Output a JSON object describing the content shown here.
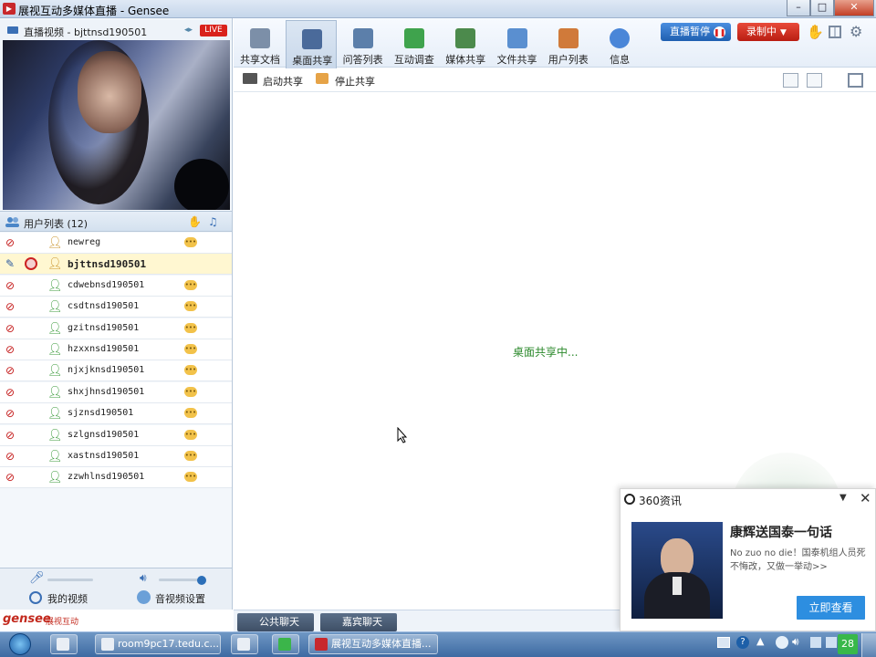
{
  "window": {
    "title": "展视互动多媒体直播 - Gensee",
    "app_icon": "gensee-logo-icon",
    "min": "–",
    "max": "□",
    "close": "✕"
  },
  "video_panel": {
    "title": "直播视频 - bjttnsd190501",
    "live_badge": "LIVE"
  },
  "user_list": {
    "title": "用户列表 (12)",
    "users": [
      {
        "name": "newreg",
        "role": "guest",
        "mic": "muted",
        "selected": false
      },
      {
        "name": "bjttnsd190501",
        "role": "host",
        "mic": "active",
        "selected": true
      },
      {
        "name": "cdwebnsd190501",
        "role": "user",
        "mic": "muted",
        "selected": false
      },
      {
        "name": "csdtnsd190501",
        "role": "user",
        "mic": "muted",
        "selected": false
      },
      {
        "name": "gzitnsd190501",
        "role": "user",
        "mic": "muted",
        "selected": false
      },
      {
        "name": "hzxxnsd190501",
        "role": "user",
        "mic": "muted",
        "selected": false
      },
      {
        "name": "njxjknsd190501",
        "role": "user",
        "mic": "muted",
        "selected": false
      },
      {
        "name": "shxjhnsd190501",
        "role": "user",
        "mic": "muted",
        "selected": false
      },
      {
        "name": "sjznsd190501",
        "role": "user",
        "mic": "muted",
        "selected": false
      },
      {
        "name": "szlgnsd190501",
        "role": "user",
        "mic": "muted",
        "selected": false
      },
      {
        "name": "xastnsd190501",
        "role": "user",
        "mic": "muted",
        "selected": false
      },
      {
        "name": "zzwhlnsd190501",
        "role": "user",
        "mic": "muted",
        "selected": false
      }
    ]
  },
  "bottom_controls": {
    "my_video": "我的视频",
    "av_settings": "音视频设置",
    "mic_level": 0.0,
    "speaker_level": 0.9
  },
  "brand": {
    "name": "gensee",
    "suffix": "展视互动"
  },
  "toolbar": {
    "items": [
      {
        "label": "共享文档",
        "icon": "document-icon",
        "active": false,
        "color": "#7c8fa8"
      },
      {
        "label": "桌面共享",
        "icon": "desktop-share-icon",
        "active": true,
        "color": "#4a6a9a"
      },
      {
        "label": "问答列表",
        "icon": "qa-list-icon",
        "active": false,
        "color": "#5c7faa"
      },
      {
        "label": "互动调查",
        "icon": "survey-chart-icon",
        "active": false,
        "color": "#3fa34d"
      },
      {
        "label": "媒体共享",
        "icon": "media-share-icon",
        "active": false,
        "color": "#4c8a4c"
      },
      {
        "label": "文件共享",
        "icon": "file-share-icon",
        "active": false,
        "color": "#5a8fd0"
      },
      {
        "label": "用户列表",
        "icon": "users-icon",
        "active": false,
        "color": "#d07a3a"
      },
      {
        "label": "信息",
        "icon": "info-icon",
        "active": false,
        "color": "#4a86d8"
      }
    ],
    "pause_live": "直播暂停",
    "recording": "录制中"
  },
  "subbar": {
    "start_share": "启动共享",
    "stop_share": "停止共享"
  },
  "canvas": {
    "status": "桌面共享中..."
  },
  "chat_tabs": {
    "public": "公共聊天",
    "guest": "嘉宾聊天"
  },
  "popup": {
    "source": "360资讯",
    "headline": "康辉送国泰一句话",
    "summary": "No zuo no die！国泰机组人员死不悔改，又做一举动>>",
    "action": "立即查看"
  },
  "taskbar": {
    "items": [
      {
        "label": "",
        "icon": "app-icon-1"
      },
      {
        "label": "room9pc17.tedu.c...",
        "icon": "vnc-icon"
      },
      {
        "label": "",
        "icon": "p-icon"
      },
      {
        "label": "",
        "icon": "green-browser-icon"
      },
      {
        "label": "展视互动多媒体直播...",
        "icon": "gensee-icon"
      }
    ],
    "clock": "28"
  },
  "colors": {
    "accent": "#2c6fb8",
    "live": "#d9221b",
    "status_text": "#2d8a2d"
  }
}
